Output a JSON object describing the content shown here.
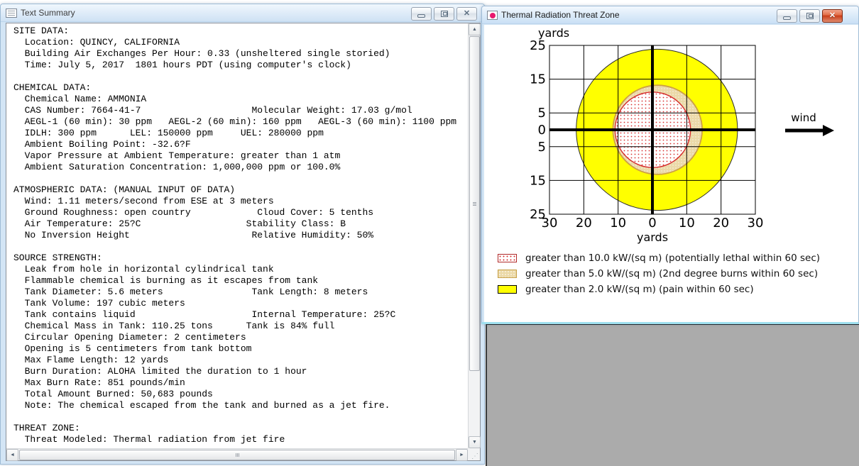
{
  "desktop": {
    "background_color": "#ABABAB"
  },
  "icons": {
    "scroll_up": "▲",
    "scroll_down": "▼",
    "scroll_left": "◄",
    "scroll_right": "►"
  },
  "text_summary_window": {
    "title": "Text Summary",
    "content_lines": [
      "SITE DATA:",
      "  Location: QUINCY, CALIFORNIA",
      "  Building Air Exchanges Per Hour: 0.33 (unsheltered single storied)",
      "  Time: July 5, 2017  1801 hours PDT (using computer's clock)",
      "",
      "CHEMICAL DATA:",
      "  Chemical Name: AMMONIA",
      "  CAS Number: 7664-41-7                    Molecular Weight: 17.03 g/mol",
      "  AEGL-1 (60 min): 30 ppm   AEGL-2 (60 min): 160 ppm   AEGL-3 (60 min): 1100 ppm",
      "  IDLH: 300 ppm      LEL: 150000 ppm     UEL: 280000 ppm",
      "  Ambient Boiling Point: -32.6?F",
      "  Vapor Pressure at Ambient Temperature: greater than 1 atm",
      "  Ambient Saturation Concentration: 1,000,000 ppm or 100.0%",
      "",
      "ATMOSPHERIC DATA: (MANUAL INPUT OF DATA)",
      "  Wind: 1.11 meters/second from ESE at 3 meters",
      "  Ground Roughness: open country            Cloud Cover: 5 tenths",
      "  Air Temperature: 25?C                   Stability Class: B",
      "  No Inversion Height                      Relative Humidity: 50%",
      "",
      "SOURCE STRENGTH:",
      "  Leak from hole in horizontal cylindrical tank",
      "  Flammable chemical is burning as it escapes from tank",
      "  Tank Diameter: 5.6 meters                Tank Length: 8 meters",
      "  Tank Volume: 197 cubic meters",
      "  Tank contains liquid                     Internal Temperature: 25?C",
      "  Chemical Mass in Tank: 110.25 tons      Tank is 84% full",
      "  Circular Opening Diameter: 2 centimeters",
      "  Opening is 5 centimeters from tank bottom",
      "  Max Flame Length: 12 yards",
      "  Burn Duration: ALOHA limited the duration to 1 hour",
      "  Max Burn Rate: 851 pounds/min",
      "  Total Amount Burned: 50,683 pounds",
      "  Note: The chemical escaped from the tank and burned as a jet fire.",
      "",
      "THREAT ZONE:",
      "  Threat Modeled: Thermal radiation from jet fire"
    ]
  },
  "threat_zone_window": {
    "title": "Thermal Radiation Threat Zone"
  },
  "chart_data": {
    "type": "area",
    "title": "Thermal Radiation Threat Zone",
    "xlabel": "yards",
    "ylabel": "yards",
    "xlim": [
      -30,
      30
    ],
    "ylim": [
      -25,
      25
    ],
    "x_ticks": [
      -30,
      -20,
      -10,
      0,
      10,
      20,
      30
    ],
    "x_tick_labels": [
      "30",
      "20",
      "10",
      "0",
      "10",
      "20",
      "30"
    ],
    "y_ticks": [
      25,
      15,
      5,
      0,
      -5,
      -15,
      -25
    ],
    "y_tick_labels": [
      "25",
      "15",
      "5",
      "0",
      "5",
      "15",
      "25"
    ],
    "grid": true,
    "legend_position": "bottom-left",
    "wind_label": "wind",
    "wind_direction": "right",
    "zones": [
      {
        "threshold_kw_per_sqm": 10.0,
        "radius_yards": 11.0,
        "downwind_offset_yards": 0.1,
        "legend": "greater than 10.0 kW/(sq m) (potentially lethal within 60 sec)",
        "swatch_style": "red-dots",
        "color": "#D83030"
      },
      {
        "threshold_kw_per_sqm": 5.0,
        "radius_yards": 13.0,
        "downwind_offset_yards": 1.5,
        "legend": "greater than 5.0 kW/(sq m) (2nd degree burns within 60 sec)",
        "swatch_style": "tan-dots",
        "color": "#C79F46"
      },
      {
        "threshold_kw_per_sqm": 2.0,
        "radius_yards": 23.5,
        "downwind_offset_yards": 1.3,
        "legend": "greater than 2.0 kW/(sq m) (pain within 60 sec)",
        "swatch_style": "yellow-solid",
        "color": "#FFFF00"
      }
    ]
  }
}
